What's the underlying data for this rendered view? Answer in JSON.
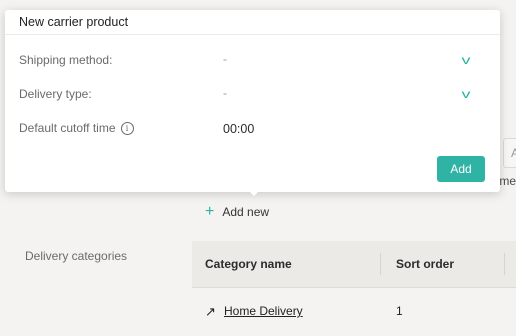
{
  "popup": {
    "title": "New carrier product",
    "shipping_method": {
      "label": "Shipping method:",
      "value": "-"
    },
    "delivery_type": {
      "label": "Delivery type:",
      "value": "-"
    },
    "cutoff": {
      "label": "Default cutoff time",
      "value": "00:00"
    },
    "add_label": "Add"
  },
  "page": {
    "add_new_label": "Add new",
    "right_panel_letter": "A",
    "right_panel_text": "tme",
    "delivery_categories_label": "Delivery categories",
    "table": {
      "columns": [
        "Category name",
        "Sort order"
      ],
      "rows": [
        {
          "name": "Home Delivery",
          "order": "1"
        }
      ]
    }
  },
  "colors": {
    "accent": "#2fb3a5"
  }
}
